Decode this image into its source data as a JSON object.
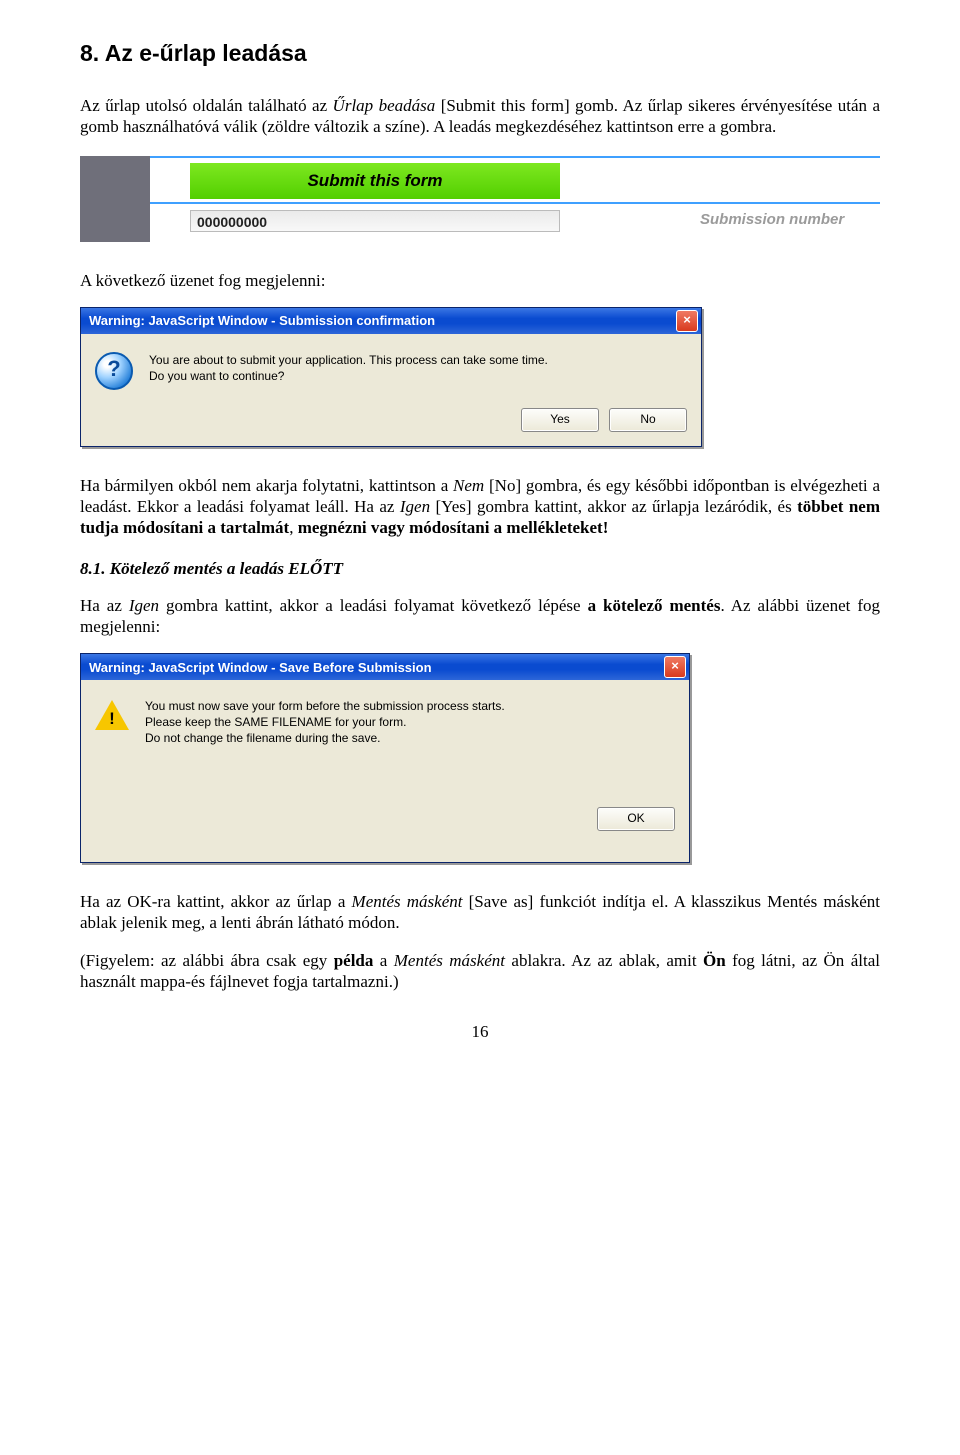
{
  "heading": "8. Az e-űrlap leadása",
  "para1_a": "Az űrlap utolsó oldalán található az ",
  "para1_i1": "Űrlap beadása",
  "para1_b": " [Submit this form] gomb. Az űrlap sikeres érvényesítése után a gomb használhatóvá válik (zöldre változik a színe). A leadás megkezdéséhez kattintson erre a gombra.",
  "submit_button_label": "Submit this form",
  "submission_number_value": "000000000",
  "submission_number_label": "Submission number",
  "para2": "A következő üzenet fog megjelenni:",
  "dialog1": {
    "title": "Warning: JavaScript Window - Submission confirmation",
    "text": "You are about to submit your application. This process can take some time.\nDo you want to continue?",
    "yes": "Yes",
    "no": "No"
  },
  "para3_a": "Ha bármilyen okból nem akarja folytatni, kattintson a ",
  "para3_i1": "Nem",
  "para3_b": " [No] gombra, és egy későbbi időpontban is elvégezheti a leadást. Ekkor a leadási folyamat leáll. Ha az ",
  "para3_i2": "Igen",
  "para3_c": " [Yes] gombra kattint, akkor az űrlapja lezáródik, és ",
  "para3_bold": "többet nem tudja módosítani a tartalmát",
  "para3_d": ", ",
  "para3_bold2": "megnézni vagy módosítani a mellékleteket!",
  "subheading": "8.1. Kötelező mentés a leadás ELŐTT",
  "para4_a": "Ha az ",
  "para4_i1": "Igen",
  "para4_b": " gombra kattint, akkor a leadási folyamat következő lépése ",
  "para4_bold": "a kötelező mentés",
  "para4_c": ". Az alábbi üzenet fog megjelenni:",
  "dialog2": {
    "title": "Warning: JavaScript Window - Save Before Submission",
    "text": "You must now save your form before the submission process starts.\nPlease keep the SAME FILENAME for your form.\nDo not change the filename during the save.",
    "ok": "OK"
  },
  "para5_a": "Ha az OK-ra kattint, akkor az űrlap a ",
  "para5_i1": "Mentés másként",
  "para5_b": " [Save as] funkciót indítja el. A klasszikus Mentés másként ablak jelenik meg, a lenti ábrán látható módon.",
  "para6_a": "(Figyelem: az alábbi ábra csak egy ",
  "para6_bold1": "példa",
  "para6_b": " a ",
  "para6_i1": "Mentés másként",
  "para6_c": " ablakra. Az az ablak, amit ",
  "para6_bold2": "Ön",
  "para6_d": " fog látni, az Ön által használt mappa-és fájlnevet fogja tartalmazni.)",
  "page_number": "16"
}
